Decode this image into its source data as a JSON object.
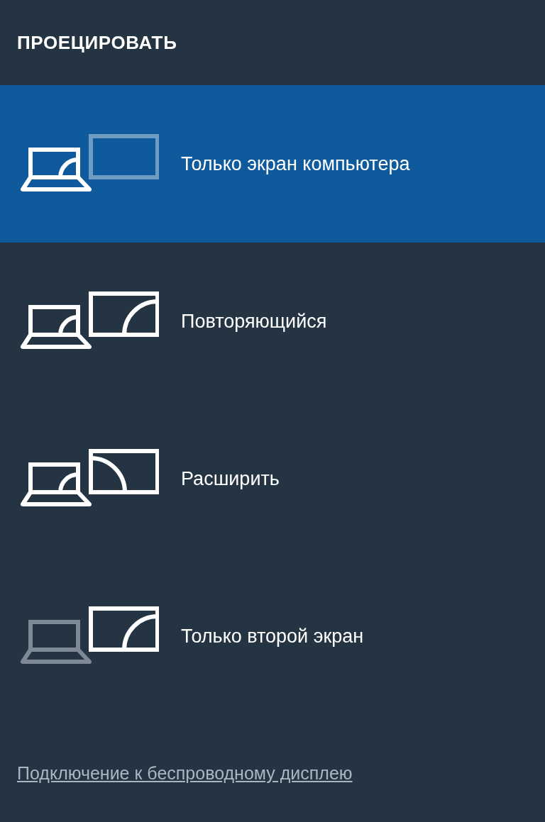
{
  "title": "ПРОЕЦИРОВАТЬ",
  "options": [
    {
      "label": "Только экран компьютера",
      "kind": "pc_only",
      "selected": true
    },
    {
      "label": "Повторяющийся",
      "kind": "duplicate",
      "selected": false
    },
    {
      "label": "Расширить",
      "kind": "extend",
      "selected": false
    },
    {
      "label": "Только второй экран",
      "kind": "second_only",
      "selected": false
    }
  ],
  "link": "Подключение к беспроводному дисплею"
}
